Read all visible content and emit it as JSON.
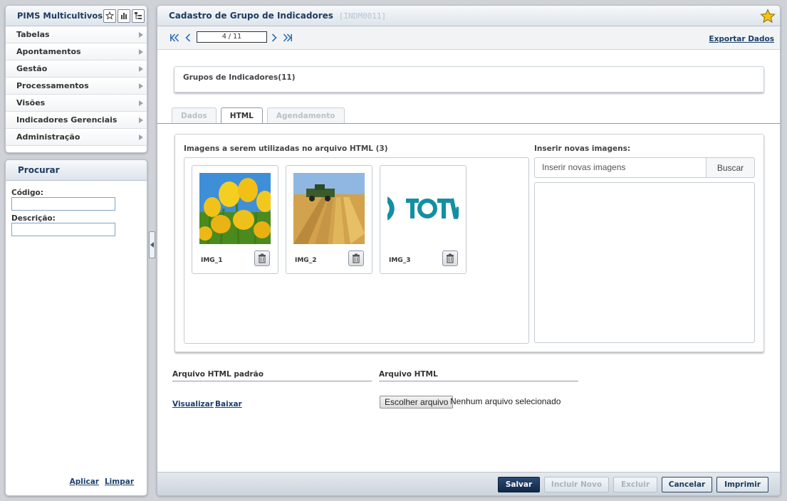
{
  "sidebar": {
    "app_title": "PIMS Multicultivos",
    "menu": [
      {
        "label": "Tabelas"
      },
      {
        "label": "Apontamentos"
      },
      {
        "label": "Gestão"
      },
      {
        "label": "Processamentos"
      },
      {
        "label": "Visões"
      },
      {
        "label": "Indicadores Gerenciais"
      },
      {
        "label": "Administração"
      }
    ],
    "search": {
      "title": "Procurar",
      "codigo_label": "Código:",
      "codigo_value": "",
      "descricao_label": "Descrição:",
      "descricao_value": "",
      "apply_label": "Aplicar",
      "clear_label": "Limpar"
    }
  },
  "header": {
    "title": "Cadastro de Grupo de Indicadores",
    "code": "[INDM0011]"
  },
  "toolbar": {
    "pager_value": "4 / 11",
    "export_label": "Exportar Dados"
  },
  "group": {
    "title": "Grupos de Indicadores(11)"
  },
  "tabs": [
    {
      "label": "Dados",
      "state": "disabled"
    },
    {
      "label": "HTML",
      "state": "active"
    },
    {
      "label": "Agendamento",
      "state": "disabled"
    }
  ],
  "html_tab": {
    "images_title": "Imagens a serem utilizadas no arquivo HTML (3)",
    "images": [
      {
        "name": "IMG_1",
        "icon": "tulips-photo"
      },
      {
        "name": "IMG_2",
        "icon": "wheat-harvest-photo"
      },
      {
        "name": "IMG_3",
        "icon": "totvs-logo"
      }
    ],
    "insert_title": "Inserir novas imagens:",
    "insert_placeholder": "Inserir novas imagens",
    "search_button": "Buscar",
    "default_file_title": "Arquivo HTML padrão",
    "view_label": "Visualizar",
    "download_label": "Baixar",
    "html_file_title": "Arquivo HTML",
    "choose_file_label": "Escolher arquivo",
    "no_file_label": "Nenhum arquivo selecionado"
  },
  "footer": {
    "save": "Salvar",
    "new": "Incluir Novo",
    "delete": "Excluir",
    "cancel": "Cancelar",
    "print": "Imprimir"
  },
  "colors": {
    "title_blue": "#1e3a5f",
    "primary_button": "#112847",
    "star": "#f2c418"
  }
}
